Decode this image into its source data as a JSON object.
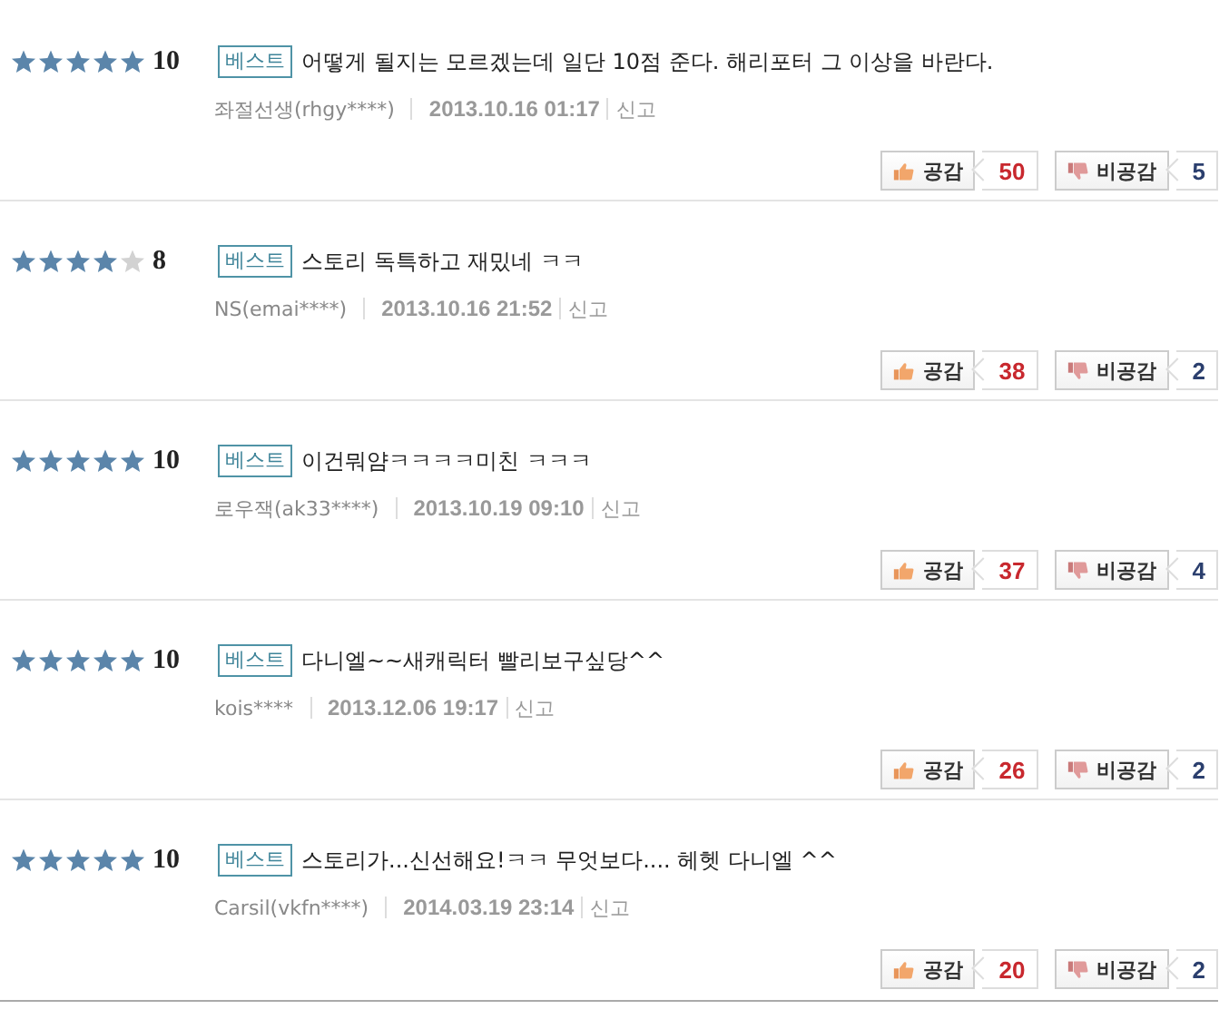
{
  "reviews": [
    {
      "stars": 5,
      "score": "10",
      "badge": "베스트",
      "text": "어떻게 될지는 모르겠는데 일단 10점 준다. 해리포터 그 이상을 바란다.",
      "author": "좌절선생(rhgy****)",
      "date": "2013.10.16 01:17",
      "report": "신고",
      "like_label": "공감",
      "likes": "50",
      "dislike_label": "비공감",
      "dislikes": "5"
    },
    {
      "stars": 4,
      "score": "8",
      "badge": "베스트",
      "text": "스토리 독특하고 재밌네 ㅋㅋ",
      "author": "NS(emai****)",
      "date": "2013.10.16 21:52",
      "report": "신고",
      "like_label": "공감",
      "likes": "38",
      "dislike_label": "비공감",
      "dislikes": "2"
    },
    {
      "stars": 5,
      "score": "10",
      "badge": "베스트",
      "text": "이건뭐얌ㅋㅋㅋㅋ미친 ㅋㅋㅋ",
      "author": "로우잭(ak33****)",
      "date": "2013.10.19 09:10",
      "report": "신고",
      "like_label": "공감",
      "likes": "37",
      "dislike_label": "비공감",
      "dislikes": "4"
    },
    {
      "stars": 5,
      "score": "10",
      "badge": "베스트",
      "text": "다니엘~~새캐릭터 빨리보구싶당^^",
      "author": "kois****",
      "date": "2013.12.06 19:17",
      "report": "신고",
      "like_label": "공감",
      "likes": "26",
      "dislike_label": "비공감",
      "dislikes": "2"
    },
    {
      "stars": 5,
      "score": "10",
      "badge": "베스트",
      "text": "스토리가...신선해요!ㅋㅋ 무엇보다.... 헤헷 다니엘 ^^",
      "author": "Carsil(vkfn****)",
      "date": "2014.03.19 23:14",
      "report": "신고",
      "like_label": "공감",
      "likes": "20",
      "dislike_label": "비공감",
      "dislikes": "2"
    }
  ]
}
